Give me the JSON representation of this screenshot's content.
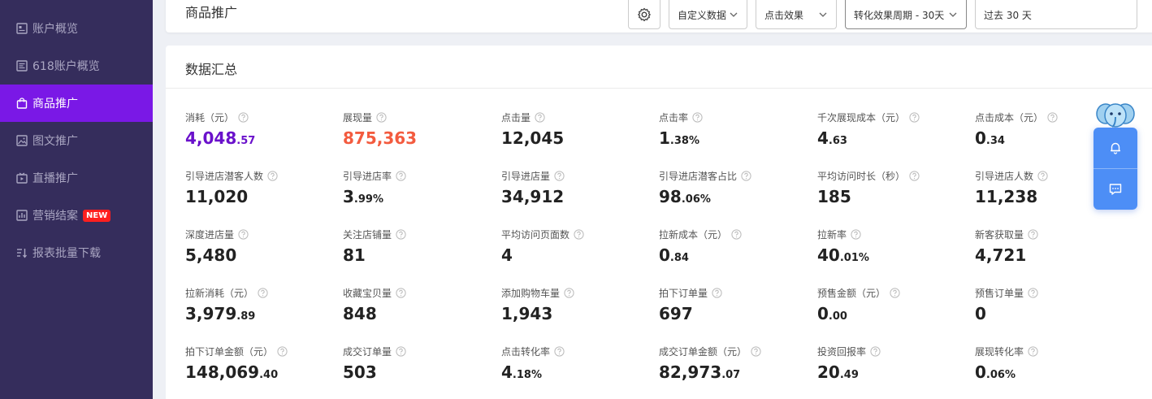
{
  "sidebar": {
    "items": [
      {
        "label": "账户概览",
        "icon": "dashboard-icon"
      },
      {
        "label": "618账户概览",
        "icon": "dashboard-alt-icon"
      },
      {
        "label": "商品推广",
        "icon": "shopping-bag-icon",
        "active": true
      },
      {
        "label": "图文推广",
        "icon": "image-icon"
      },
      {
        "label": "直播推广",
        "icon": "live-video-icon"
      },
      {
        "label": "营销结案",
        "icon": "report-icon",
        "badge": "NEW"
      },
      {
        "label": "报表批量下载",
        "icon": "sort-download-icon"
      }
    ]
  },
  "header": {
    "title": "商品推广",
    "custom_data": "自定义数据",
    "click_effect": "点击效果",
    "conversion_period": "转化效果周期 - 30天",
    "date_range": "过去 30 天"
  },
  "summary": {
    "title": "数据汇总",
    "metrics": [
      {
        "label": "消耗（元）",
        "int": "4,048",
        "dec": ".57"
      },
      {
        "label": "展现量",
        "int": "875,363",
        "dec": ""
      },
      {
        "label": "点击量",
        "int": "12,045",
        "dec": ""
      },
      {
        "label": "点击率",
        "int": "1",
        "dec": ".38%"
      },
      {
        "label": "千次展现成本（元）",
        "int": "4",
        "dec": ".63"
      },
      {
        "label": "点击成本（元）",
        "int": "0",
        "dec": ".34"
      },
      {
        "label": "引导进店潜客人数",
        "int": "11,020",
        "dec": ""
      },
      {
        "label": "引导进店率",
        "int": "3",
        "dec": ".99%"
      },
      {
        "label": "引导进店量",
        "int": "34,912",
        "dec": ""
      },
      {
        "label": "引导进店潜客占比",
        "int": "98",
        "dec": ".06%"
      },
      {
        "label": "平均访问时长（秒）",
        "int": "185",
        "dec": ""
      },
      {
        "label": "引导进店人数",
        "int": "11,238",
        "dec": ""
      },
      {
        "label": "深度进店量",
        "int": "5,480",
        "dec": ""
      },
      {
        "label": "关注店铺量",
        "int": "81",
        "dec": ""
      },
      {
        "label": "平均访问页面数",
        "int": "4",
        "dec": ""
      },
      {
        "label": "拉新成本（元）",
        "int": "0",
        "dec": ".84"
      },
      {
        "label": "拉新率",
        "int": "40",
        "dec": ".01%"
      },
      {
        "label": "新客获取量",
        "int": "4,721",
        "dec": ""
      },
      {
        "label": "拉新消耗（元）",
        "int": "3,979",
        "dec": ".89"
      },
      {
        "label": "收藏宝贝量",
        "int": "848",
        "dec": ""
      },
      {
        "label": "添加购物车量",
        "int": "1,943",
        "dec": ""
      },
      {
        "label": "拍下订单量",
        "int": "697",
        "dec": ""
      },
      {
        "label": "预售金额（元）",
        "int": "0",
        "dec": ".00"
      },
      {
        "label": "预售订单量",
        "int": "0",
        "dec": ""
      },
      {
        "label": "拍下订单金额（元）",
        "int": "148,069",
        "dec": ".40"
      },
      {
        "label": "成交订单量",
        "int": "503",
        "dec": ""
      },
      {
        "label": "点击转化率",
        "int": "4",
        "dec": ".18%"
      },
      {
        "label": "成交订单金额（元）",
        "int": "82,973",
        "dec": ".07"
      },
      {
        "label": "投资回报率",
        "int": "20",
        "dec": ".49"
      },
      {
        "label": "展现转化率",
        "int": "0",
        "dec": ".06%"
      }
    ]
  },
  "colors": {
    "sidebar_bg": "#352d5c",
    "active_nav": "#7a18e6",
    "spend_value": "#6a11cb",
    "impressions_value": "#f35b3f",
    "float_widget": "#4d8ef6",
    "new_badge": "#ff1f1f"
  },
  "float_widget": {
    "items": [
      "bell-icon",
      "chat-icon"
    ]
  }
}
